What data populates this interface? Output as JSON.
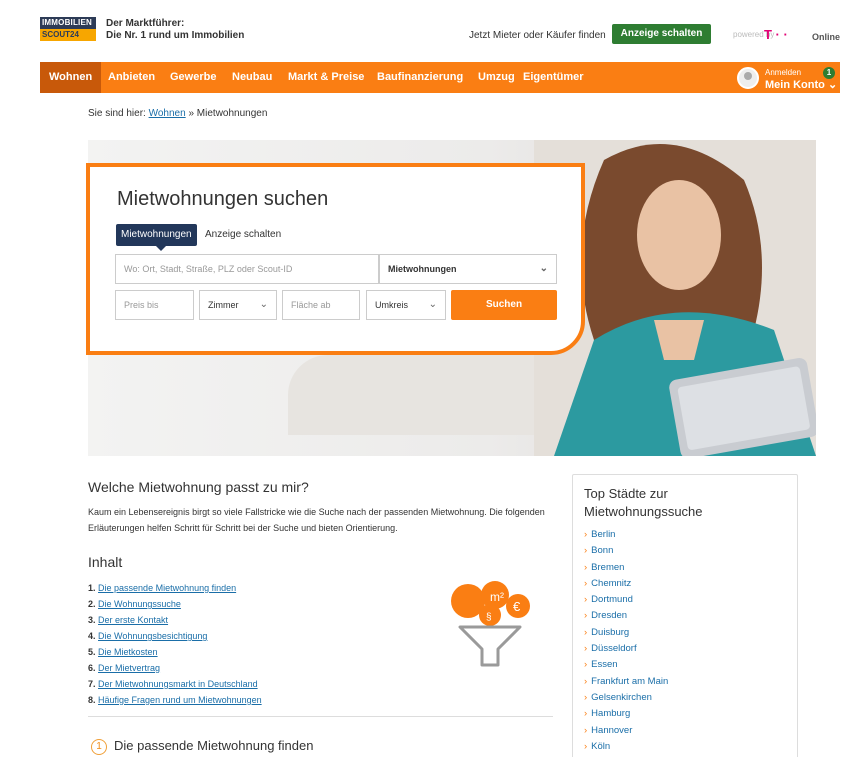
{
  "header": {
    "logo_line1": "IMMOBILIEN",
    "logo_line2": "SCOUT24",
    "tagline_1": "Der Marktführer:",
    "tagline_2": "Die Nr. 1 rund um Immobilien",
    "finder_link": "Jetzt Mieter oder Käufer finden",
    "cta": "Anzeige schalten",
    "powered_by": "powered by",
    "telekom_mark": "T · ·",
    "online": "Online"
  },
  "nav": {
    "items": [
      "Wohnen",
      "Anbieten",
      "Gewerbe",
      "Neubau",
      "Markt & Preise",
      "Baufinanzierung",
      "Umzug",
      "Eigentümer"
    ],
    "active": "Wohnen",
    "login_small": "Anmelden",
    "account": "Mein Konto",
    "account_chevron": "⌄",
    "badge": "1"
  },
  "breadcrumb": {
    "prefix": "Sie sind hier:",
    "link": "Wohnen",
    "separator": "»",
    "current": "Mietwohnungen"
  },
  "search": {
    "title": "Mietwohnungen suchen",
    "tab_active": "Mietwohnungen",
    "tab_inactive": "Anzeige schalten",
    "where_placeholder": "Wo: Ort, Stadt, Straße, PLZ oder Scout-ID",
    "type_value": "Mietwohnungen",
    "price_placeholder": "Preis bis",
    "rooms_value": "Zimmer",
    "area_placeholder": "Fläche ab",
    "radius_value": "Umkreis",
    "button": "Suchen"
  },
  "content": {
    "heading": "Welche Mietwohnung passt zu mir?",
    "intro": "Kaum ein Lebensereignis birgt so viele Fallstricke wie die Suche nach der passenden Mietwohnung. Die folgenden Erläuterungen helfen Schritt für Schritt bei der Suche und bieten Orientierung.",
    "toc_heading": "Inhalt",
    "toc": [
      {
        "num": "1.",
        "label": "Die passende Mietwohnung finden"
      },
      {
        "num": "2.",
        "label": "Die Wohnungssuche"
      },
      {
        "num": "3.",
        "label": "Der erste Kontakt"
      },
      {
        "num": "4.",
        "label": "Die Wohnungsbesichtigung"
      },
      {
        "num": "5.",
        "label": "Die Mietkosten"
      },
      {
        "num": "6.",
        "label": "Der Mietvertrag"
      },
      {
        "num": "7.",
        "label": "Der Mietwohnungsmarkt in Deutschland"
      },
      {
        "num": "8.",
        "label": "Häufige Fragen rund um Mietwohnungen"
      }
    ],
    "section_number": "1",
    "section_title": "Die passende Mietwohnung finden"
  },
  "sidebar": {
    "title": "Top Städte zur Mietwohnungssuche",
    "cities": [
      "Berlin",
      "Bonn",
      "Bremen",
      "Chemnitz",
      "Dortmund",
      "Dresden",
      "Duisburg",
      "Düsseldorf",
      "Essen",
      "Frankfurt am Main",
      "Gelsenkirchen",
      "Hamburg",
      "Hannover",
      "Köln"
    ]
  },
  "colors": {
    "orange": "#fa7e13",
    "navy": "#22375a",
    "green": "#2e7d32",
    "link": "#1a6ea8"
  }
}
